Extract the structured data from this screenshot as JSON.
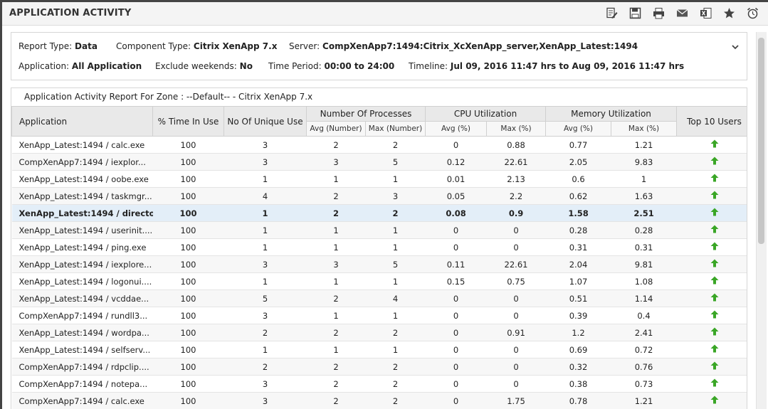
{
  "title": "APPLICATION ACTIVITY",
  "toolbar_icons": [
    "edit-report-icon",
    "save-icon",
    "print-icon",
    "email-icon",
    "excel-export-icon",
    "favorite-star-icon",
    "schedule-alarm-icon"
  ],
  "filters": {
    "report_type_label": "Report Type:",
    "report_type_value": "Data",
    "component_type_label": "Component Type:",
    "component_type_value": "Citrix XenApp 7.x",
    "server_label": "Server:",
    "server_value": "CompXenApp7:1494:Citrix_XcXenApp_server,XenApp_Latest:1494",
    "application_label": "Application:",
    "application_value": "All Application",
    "exclude_label": "Exclude weekends:",
    "exclude_value": "No",
    "time_period_label": "Time Period:",
    "time_period_value": "00:00 to 24:00",
    "timeline_label": "Timeline:",
    "timeline_value": "Jul 09, 2016 11:47 hrs to Aug 09, 2016 11:47 hrs"
  },
  "report": {
    "zone_title": "Application Activity Report For Zone : --Default-- - Citrix XenApp 7.x",
    "headers": {
      "application": "Application",
      "time_in_use": "% Time In Use",
      "unique_users": "No Of Unique Use",
      "processes": "Number Of Processes",
      "cpu": "CPU Utilization",
      "memory": "Memory Utilization",
      "top_users": "Top 10 Users",
      "proc_avg": "Avg (Number)",
      "proc_max": "Max (Number)",
      "cpu_avg": "Avg (%)",
      "cpu_max": "Max (%)",
      "mem_avg": "Avg (%)",
      "mem_max": "Max (%)"
    },
    "rows": [
      [
        "XenApp_Latest:1494 / calc.exe",
        "100",
        "3",
        "2",
        "2",
        "0",
        "0.88",
        "0.77",
        "1.21"
      ],
      [
        "CompXenApp7:1494 / iexplor...",
        "100",
        "3",
        "3",
        "5",
        "0.12",
        "22.61",
        "2.05",
        "9.83"
      ],
      [
        "XenApp_Latest:1494 / oobe.exe",
        "100",
        "1",
        "1",
        "1",
        "0.01",
        "2.13",
        "0.6",
        "1"
      ],
      [
        "XenApp_Latest:1494 / taskmgr...",
        "100",
        "4",
        "2",
        "3",
        "0.05",
        "2.2",
        "0.62",
        "1.63"
      ],
      [
        "XenApp_Latest:1494 / directo...",
        "100",
        "1",
        "2",
        "2",
        "0.08",
        "0.9",
        "1.58",
        "2.51"
      ],
      [
        "XenApp_Latest:1494 / userinit....",
        "100",
        "1",
        "1",
        "1",
        "0",
        "0",
        "0.28",
        "0.28"
      ],
      [
        "XenApp_Latest:1494 / ping.exe",
        "100",
        "1",
        "1",
        "1",
        "0",
        "0",
        "0.31",
        "0.31"
      ],
      [
        "XenApp_Latest:1494 / iexplore...",
        "100",
        "3",
        "3",
        "5",
        "0.11",
        "22.61",
        "2.04",
        "9.81"
      ],
      [
        "XenApp_Latest:1494 / logonui....",
        "100",
        "1",
        "1",
        "1",
        "0.15",
        "0.75",
        "1.07",
        "1.08"
      ],
      [
        "XenApp_Latest:1494 / vcddae...",
        "100",
        "5",
        "2",
        "4",
        "0",
        "0",
        "0.51",
        "1.14"
      ],
      [
        "CompXenApp7:1494 / rundll3...",
        "100",
        "3",
        "1",
        "1",
        "0",
        "0",
        "0.39",
        "0.4"
      ],
      [
        "XenApp_Latest:1494 / wordpa...",
        "100",
        "2",
        "2",
        "2",
        "0",
        "0.91",
        "1.2",
        "2.41"
      ],
      [
        "XenApp_Latest:1494 / selfserv...",
        "100",
        "1",
        "1",
        "1",
        "0",
        "0",
        "0.69",
        "0.72"
      ],
      [
        "CompXenApp7:1494 / rdpclip....",
        "100",
        "2",
        "2",
        "2",
        "0",
        "0",
        "0.32",
        "0.76"
      ],
      [
        "CompXenApp7:1494 / notepa...",
        "100",
        "3",
        "2",
        "2",
        "0",
        "0",
        "0.38",
        "0.73"
      ],
      [
        "CompXenApp7:1494 / calc.exe",
        "100",
        "3",
        "2",
        "2",
        "0",
        "1.75",
        "0.78",
        "1.21"
      ]
    ],
    "selected_row": 4
  },
  "colors": {
    "arrow_green": "#3aa626",
    "selected_row": "#e3eef8",
    "header_bg": "#e9e9e9"
  }
}
